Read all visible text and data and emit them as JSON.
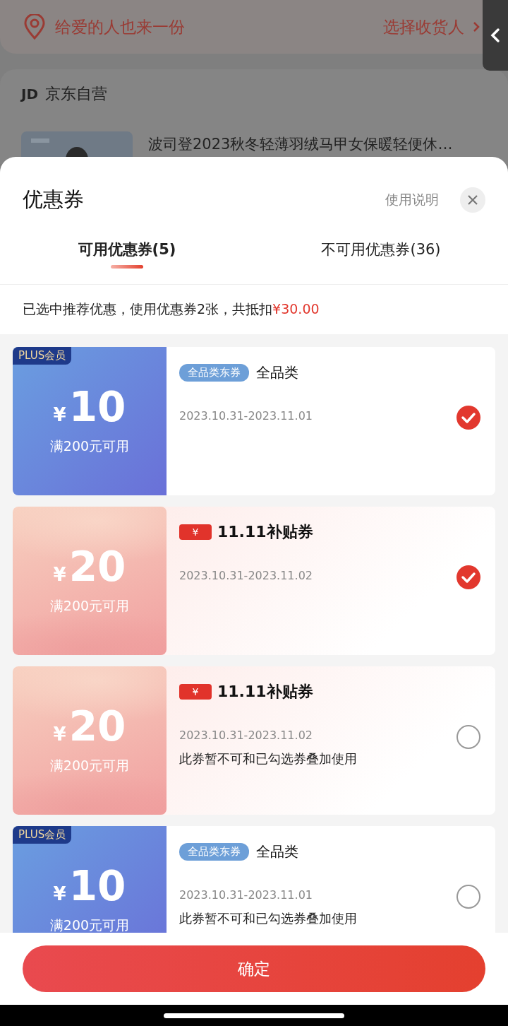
{
  "background": {
    "gift_text": "给爱的人也来一份",
    "recipient_link": "选择收货人",
    "shop_logo": "JD",
    "shop_name": "京东自营",
    "product_title": "波司登2023秋冬轻薄羽绒马甲女保暖轻便休…"
  },
  "sheet": {
    "title": "优惠券",
    "help_link": "使用说明",
    "tabs": [
      {
        "label": "可用优惠券(5)",
        "selected": true
      },
      {
        "label": "不可用优惠券(36)",
        "selected": false
      }
    ],
    "summary": {
      "text": "已选中推荐优惠，使用优惠券2张，共抵扣",
      "amount": "¥30.00"
    },
    "coupons": [
      {
        "kind": "plus",
        "badge": "PLUS会员",
        "currency": "¥",
        "amount": "10",
        "condition": "满200元可用",
        "tag": "全品类东券",
        "title": "全品类",
        "date": "2023.10.31-2023.11.01",
        "selected": true
      },
      {
        "kind": "subsidy",
        "logo_symbol": "¥",
        "title": "11.11补贴券",
        "currency": "¥",
        "amount": "20",
        "condition": "满200元可用",
        "date": "2023.10.31-2023.11.02",
        "selected": true
      },
      {
        "kind": "subsidy",
        "logo_symbol": "¥",
        "title": "11.11补贴券",
        "currency": "¥",
        "amount": "20",
        "condition": "满200元可用",
        "date": "2023.10.31-2023.11.02",
        "note": "此券暂不可和已勾选券叠加使用",
        "selected": false
      },
      {
        "kind": "plus",
        "badge": "PLUS会员",
        "currency": "¥",
        "amount": "10",
        "condition": "满200元可用",
        "tag": "全品类东券",
        "title": "全品类",
        "date": "2023.10.31-2023.11.01",
        "note": "此券暂不可和已勾选券叠加使用",
        "selected": false
      }
    ],
    "confirm_button": "确定"
  }
}
